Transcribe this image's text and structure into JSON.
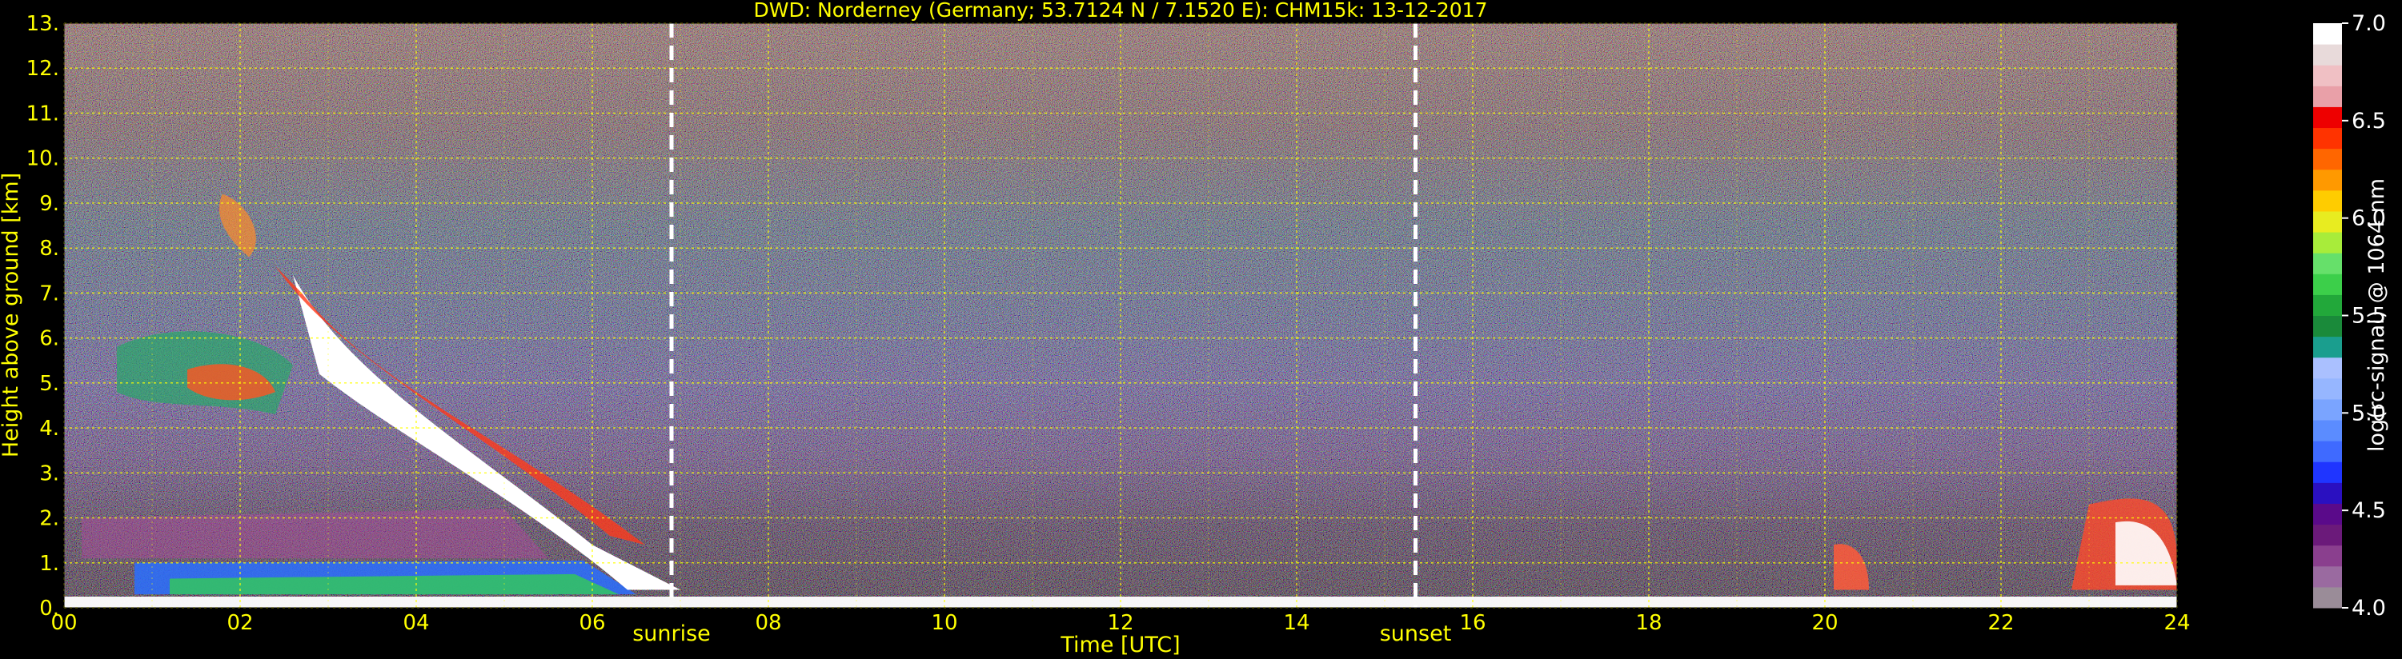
{
  "chart_data": {
    "type": "heatmap",
    "title": "DWD: Norderney (Germany; 53.7124 N / 7.1520 E):    CHM15k: 13-12-2017",
    "xlabel": "Time [UTC]",
    "ylabel": "Height above ground [km]",
    "xlim": [
      0,
      24
    ],
    "ylim": [
      0,
      13
    ],
    "x_ticks": [
      "00",
      "02",
      "04",
      "06",
      "08",
      "10",
      "12",
      "14",
      "16",
      "18",
      "20",
      "22",
      "24"
    ],
    "y_ticks": [
      "0.",
      "1.",
      "2.",
      "3.",
      "4.",
      "5.",
      "6.",
      "7.",
      "8.",
      "9.",
      "10.",
      "11.",
      "12.",
      "13."
    ],
    "grid": true,
    "markers": [
      {
        "label": "sunrise",
        "time_utc": 6.9
      },
      {
        "label": "sunset",
        "time_utc": 15.35
      }
    ],
    "colorbar": {
      "label": "log(rc-signal) @ 1064 nm",
      "range": [
        4.0,
        7.0
      ],
      "ticks": [
        "4.0",
        "4.5",
        "5.0",
        "5.5",
        "6.0",
        "6.5",
        "7.0"
      ],
      "colors": [
        "#9a8c98",
        "#9a6aa0",
        "#8a3f8e",
        "#6b1a7a",
        "#5a0a8a",
        "#2a10c0",
        "#1f35ff",
        "#3f6aff",
        "#5b8cff",
        "#7aa4ff",
        "#96b6ff",
        "#aac0ff",
        "#1a9e8e",
        "#1a8a3a",
        "#22a83a",
        "#3ccf4a",
        "#66e06a",
        "#a8ec3a",
        "#e8ec20",
        "#ffcc00",
        "#ff9900",
        "#ff6600",
        "#ff3300",
        "#ee0000",
        "#e9a0a8",
        "#f0c0c4",
        "#e8dada",
        "#ffffff"
      ]
    }
  }
}
